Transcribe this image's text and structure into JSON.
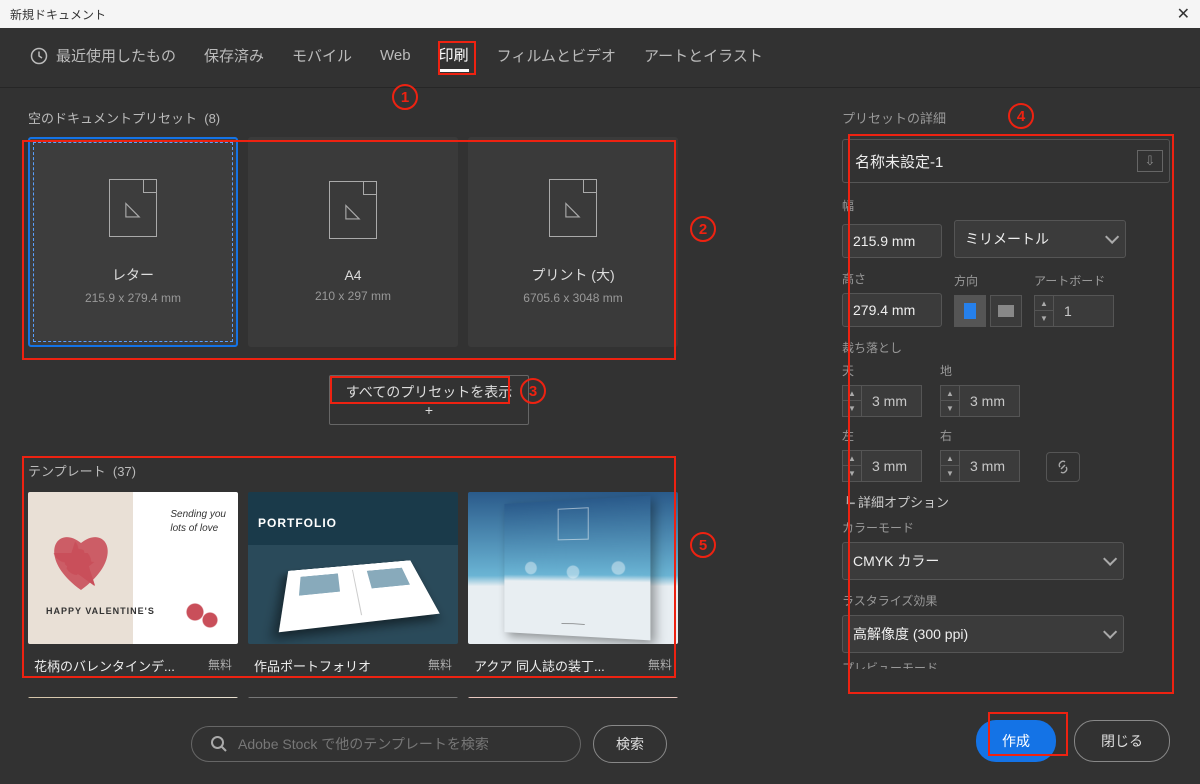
{
  "title": "新規ドキュメント",
  "tabs": {
    "recent": "最近使用したもの",
    "saved": "保存済み",
    "mobile": "モバイル",
    "web": "Web",
    "print": "印刷",
    "film": "フィルムとビデオ",
    "art": "アートとイラスト"
  },
  "left": {
    "blank_presets_label": "空のドキュメントプリセット",
    "blank_presets_count": "(8)",
    "cards": [
      {
        "name": "レター",
        "dims": "215.9 x 279.4 mm"
      },
      {
        "name": "A4",
        "dims": "210 x 297 mm"
      },
      {
        "name": "プリント (大)",
        "dims": "6705.6 x 3048 mm"
      }
    ],
    "show_all": "すべてのプリセットを表示 +",
    "templates_label": "テンプレート",
    "templates_count": "(37)",
    "templates": [
      {
        "name": "花柄のバレンタインデ...",
        "tag": "無料"
      },
      {
        "name": "作品ポートフォリオ",
        "tag": "無料"
      },
      {
        "name": "アクア 同人誌の装丁...",
        "tag": "無料"
      }
    ],
    "t1_line1": "Sending you",
    "t1_line2": "lots of love",
    "t1_hv": "HAPPY VALENTINE'S",
    "t2_pf": "PORTFOLIO",
    "search_placeholder": "Adobe Stock で他のテンプレートを検索",
    "search_btn": "検索"
  },
  "right": {
    "preset_details": "プリセットの詳細",
    "doc_name": "名称未設定-1",
    "width_label": "幅",
    "width_value": "215.9 mm",
    "units": "ミリメートル",
    "height_label": "高さ",
    "height_value": "279.4 mm",
    "orient_label": "方向",
    "artboard_label": "アートボード",
    "artboard_value": "1",
    "bleed_label": "裁ち落とし",
    "top": "天",
    "bottom": "地",
    "left": "左",
    "right": "右",
    "bleed_val": "3 mm",
    "advanced": "詳細オプション",
    "colormode_label": "カラーモード",
    "colormode_value": "CMYK カラー",
    "raster_label": "ラスタライズ効果",
    "raster_value": "高解像度 (300 ppi)",
    "preview_cut": "プレビューモード",
    "create": "作成",
    "close": "閉じる"
  },
  "annotations": {
    "1": "1",
    "2": "2",
    "3": "3",
    "4": "4",
    "5": "5"
  }
}
